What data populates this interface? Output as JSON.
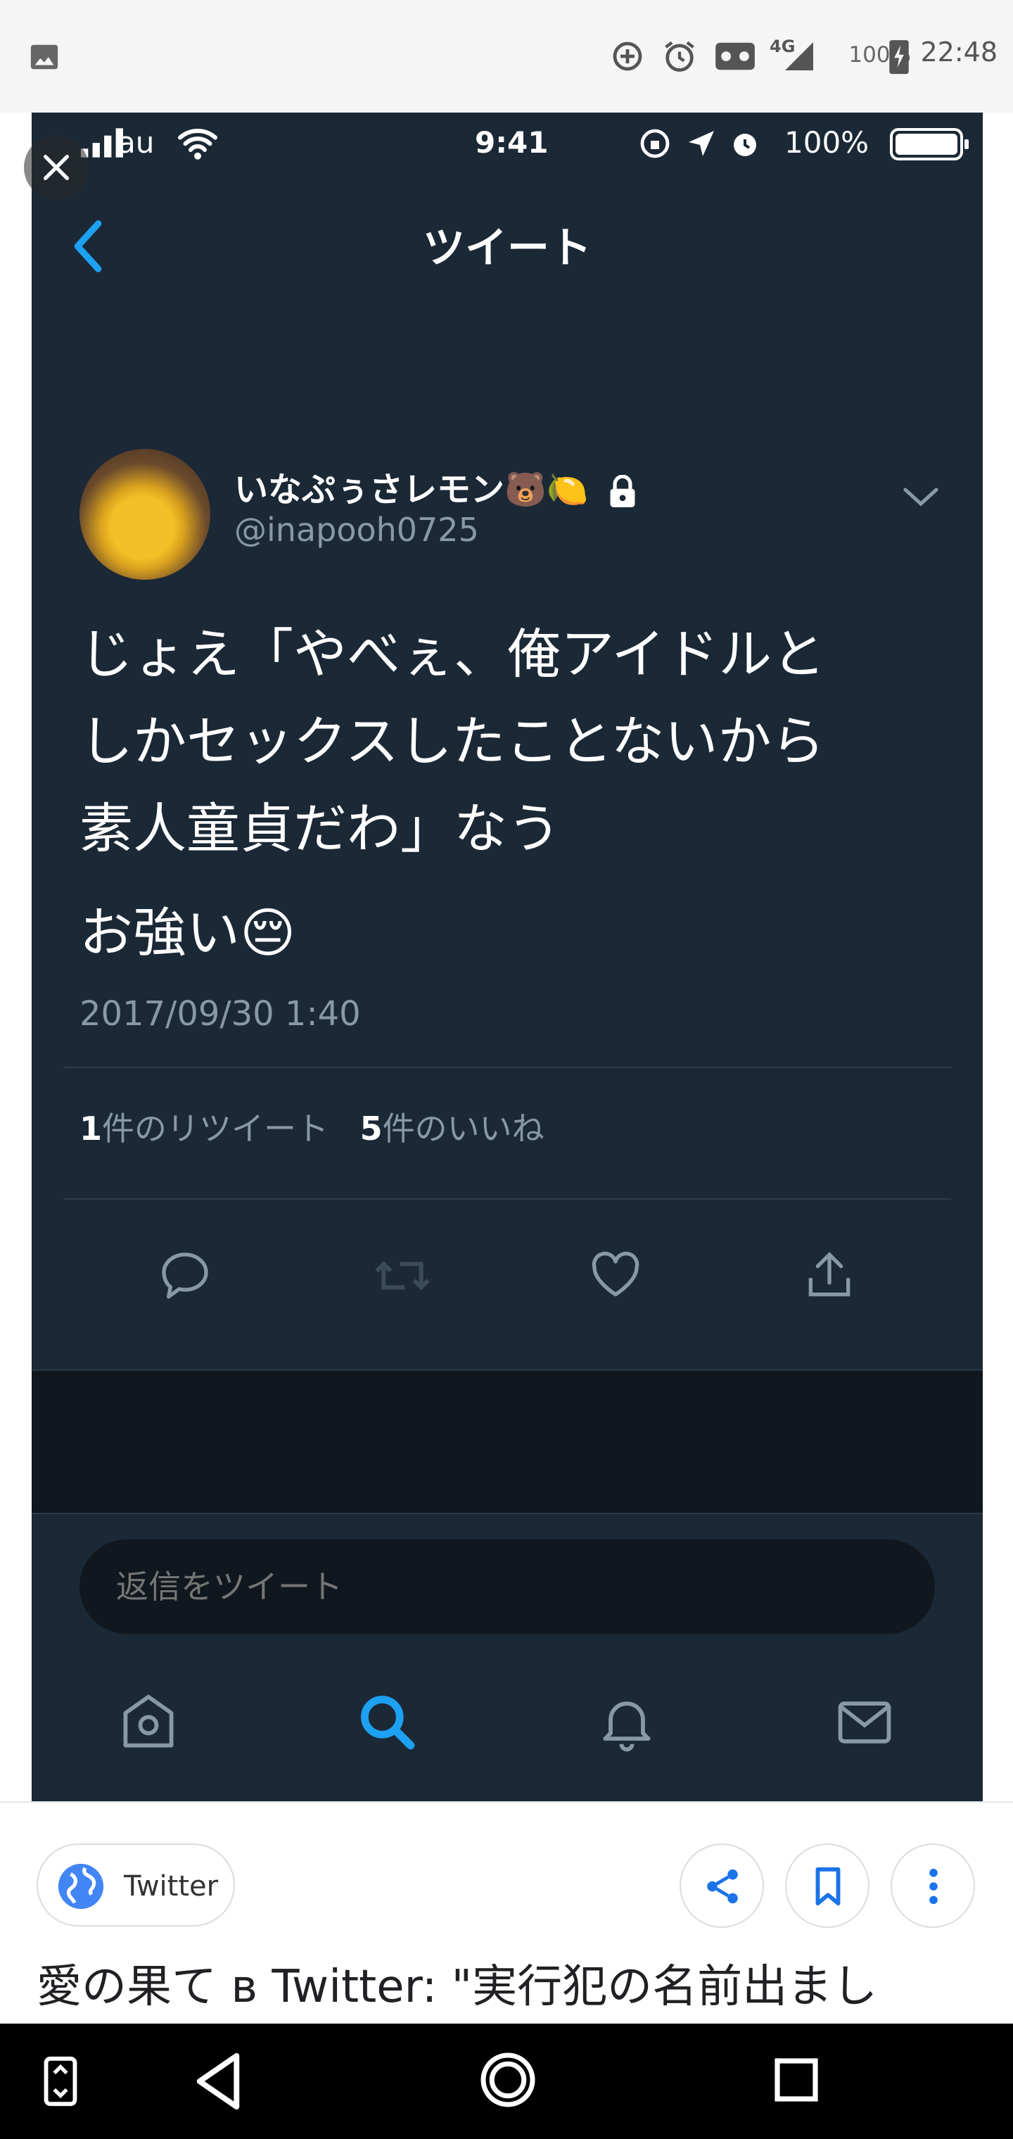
{
  "android_status": {
    "time": "22:48",
    "battery": "100%",
    "network": "4G",
    "icons": [
      "image-icon",
      "sync-icon",
      "alarm-icon",
      "voicemail-icon",
      "signal-icon",
      "battery-charging-icon"
    ]
  },
  "ios_status": {
    "carrier": "au",
    "time": "9:41",
    "battery": "100%"
  },
  "tweet_page": {
    "title": "ツイート",
    "back_icon": "chevron-left-icon"
  },
  "tweet": {
    "display_name": "いなぷぅさレモン",
    "name_emojis": [
      "🐻",
      "🍋"
    ],
    "lock_icon": "lock-icon",
    "handle": "@inapooh0725",
    "text_lines": [
      "じょえ「やべぇ、俺アイドルと",
      "しかセックスしたことないから",
      "素人童貞だわ」なう"
    ],
    "text_line2": "お強い",
    "text_emoji": "😔",
    "date": "2017/09/30 1:40",
    "retweets_count": "1",
    "retweets_label": "件のリツイート",
    "likes_count": "5",
    "likes_label": "件のいいね"
  },
  "reply": {
    "placeholder": "返信をツイート"
  },
  "tab_bar": {
    "items": [
      "home-icon",
      "search-icon",
      "bell-icon",
      "mail-icon"
    ],
    "active": "search-icon"
  },
  "info": {
    "source_label": "Twitter",
    "title": "愛の果て в Twitter: \"実行犯の名前出まし"
  },
  "colors": {
    "accent": "#1da1f2",
    "background": "#1b2836",
    "dark": "#10171e",
    "muted": "#8899a6"
  }
}
